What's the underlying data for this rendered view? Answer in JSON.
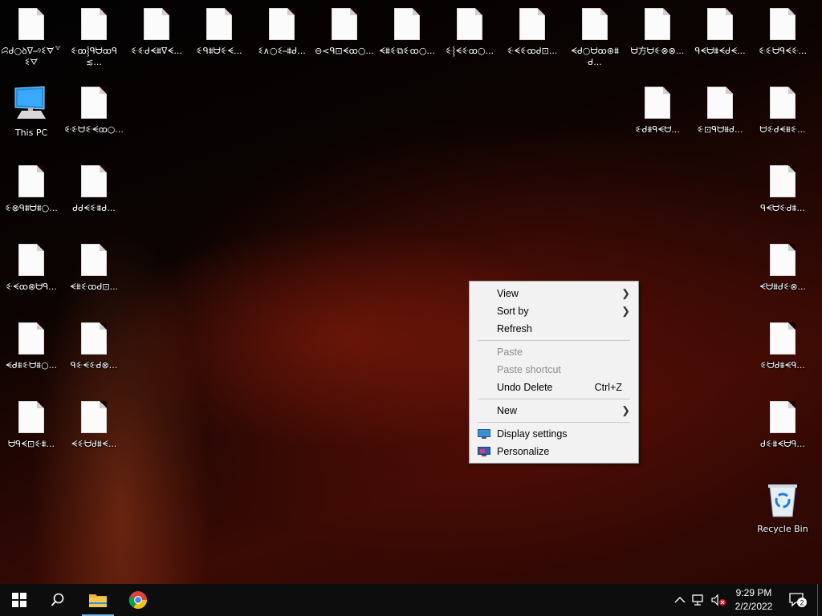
{
  "desktop": {
    "this_pc_label": "This PC",
    "recycle_bin_label": "Recycle Bin",
    "files": [
      "ꗱᑯ○ꝺᐁ⎯ꝰꗨᗊ꒷ꗨᗊ",
      "ꗩꝏ⸾ᑫᗨꝏᑫ≲...",
      "ꗩꗩᑯᗕ⩩ᐁᗕ...",
      "ꗩᑫ⩩ᗨꗩᗕ...",
      "ꗨ∧○ꗨ⎯⩩ᑯ...",
      "⊖<ᑫ⊡ᗕꝏ○...",
      "ᗕ⩩ꗩ⧉ꗩꝏ○...",
      "ꗩ⸾ᗕꗩꝏ○...",
      "ꗩᗕꗩꝏᑯ⊡...",
      "ᗕᑯ○ᗨꝏ⊛⩩ᑯ...",
      "ᗨ方ᗨꗩ⊗⊗...",
      "ᑫᗕᗨ⩩ᗕᑯᗕ...",
      "ꗩꗩᗨᑫᗕꗩ...",
      "ꗩꗩᗨꗩᗕꝏ○...",
      "ꗩ⊗ᑫ⩩ᗨ⩩○...",
      "ᑯᑯᗕꗩ⩩ᑯ...",
      "ꗩᗕꝏ⊗ᗨᑫ...",
      "ᗕ⩩ꗩꝏᑯ⊡...",
      "ᗕᑯ⩩ꗩᗨ⩩○...",
      "ᑫꗩᗕꗩᑯ⊗...",
      "ᗨᑫᗕ⊡ꗩ⩩...",
      "ᗕꗩᗨᑯ⩩ᗕ...",
      "ꗩᑯ⩩ᑫᗕᗨ...",
      "ꗩ⊡ᑫᗨ⩩ᑯ...",
      "ᗨꗩᑯᗕ⩩ꗩ...",
      "ᑫᗕᗨꗩᑯ⩩...",
      "ᗕᗨ⩩ᑯꗩ⊗...",
      "ꗩᗨᑯ⩩ᗕᑫ...",
      "ᑯꗩ⩩ᗕᗨᑫ...",
      "ᗕᑯᗨ⩩ꗩ⊡..."
    ]
  },
  "context_menu": {
    "view": "View",
    "sort_by": "Sort by",
    "refresh": "Refresh",
    "paste": "Paste",
    "paste_shortcut": "Paste shortcut",
    "undo_delete": "Undo Delete",
    "undo_delete_shortcut": "Ctrl+Z",
    "new": "New",
    "display_settings": "Display settings",
    "personalize": "Personalize"
  },
  "taskbar": {
    "time": "9:29 PM",
    "date": "2/2/2022",
    "notification_count": "2"
  },
  "colors": {
    "accent": "#76b9ed",
    "taskbar": "#0d0d0d",
    "menu_bg": "#f2f2f2"
  }
}
